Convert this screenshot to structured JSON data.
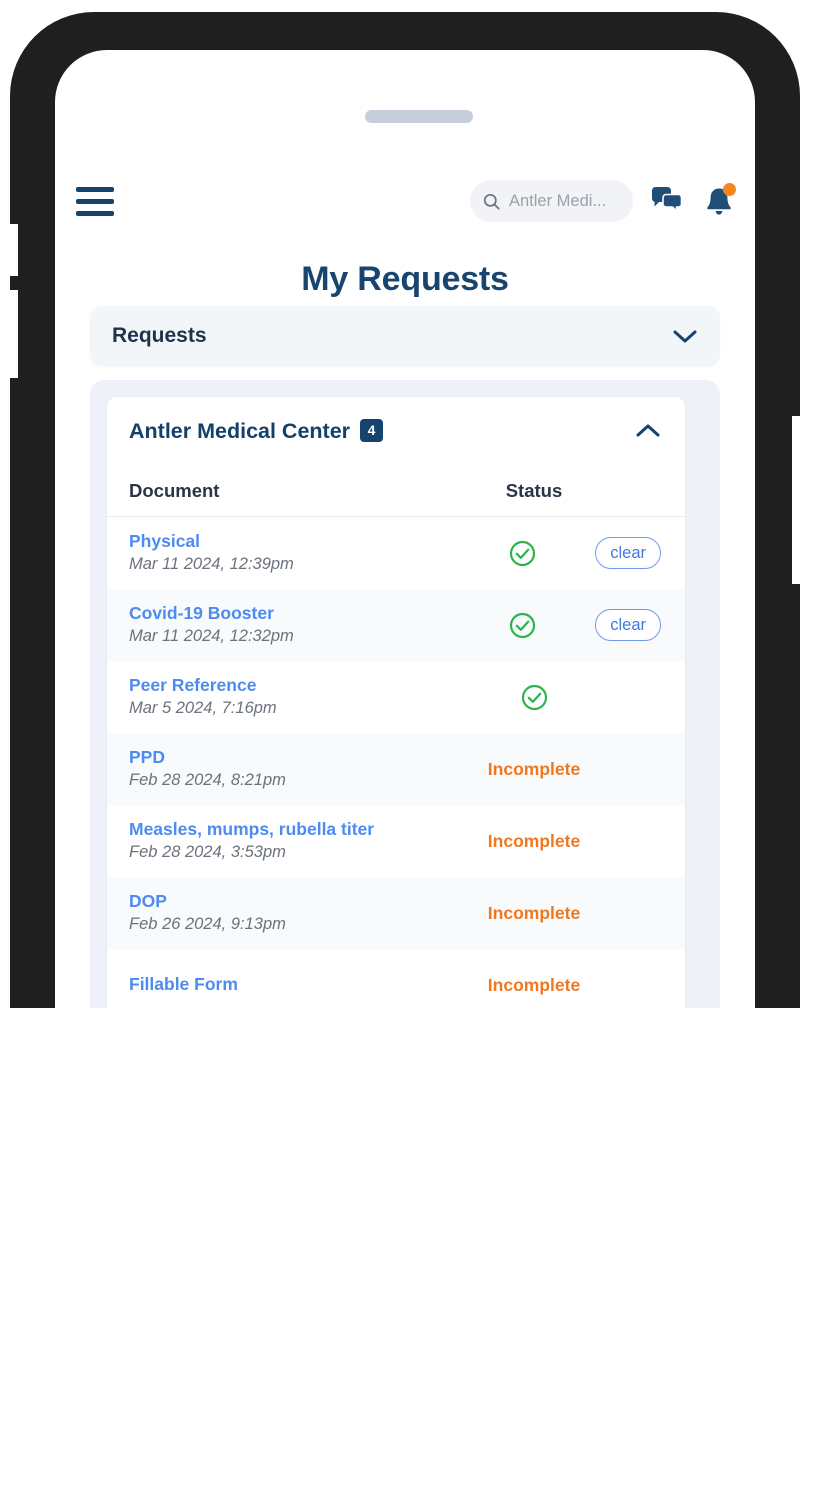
{
  "header": {
    "menu_icon": "hamburger-menu-icon",
    "search": {
      "icon": "search-icon",
      "value": "Antler Medi..."
    },
    "messages_icon": "chat-bubbles-icon",
    "notifications_icon": "bell-icon",
    "notification_badge": ""
  },
  "page": {
    "title": "My Requests"
  },
  "filter": {
    "label": "Requests",
    "chevron_icon": "chevron-down-icon"
  },
  "facility": {
    "name": "Antler Medical Center",
    "count": "4",
    "collapse_icon": "chevron-up-icon"
  },
  "table": {
    "columns": [
      "Document",
      "Status"
    ],
    "rows": [
      {
        "document": "Physical",
        "date": "Mar 11 2024, 12:39pm",
        "status": "complete",
        "status_icon": "check-circle-icon",
        "action": "clear"
      },
      {
        "document": "Covid-19 Booster",
        "date": "Mar 11 2024, 12:32pm",
        "status": "complete",
        "status_icon": "check-circle-icon",
        "action": "clear"
      },
      {
        "document": "Peer Reference",
        "date": "Mar 5 2024, 7:16pm",
        "status": "complete",
        "status_icon": "check-circle-icon",
        "action": ""
      },
      {
        "document": "PPD",
        "date": "Feb 28 2024, 8:21pm",
        "status": "Incomplete",
        "status_icon": "",
        "action": ""
      },
      {
        "document": "Measles, mumps, rubella titer",
        "date": "Feb 28 2024, 3:53pm",
        "status": "Incomplete",
        "status_icon": "",
        "action": ""
      },
      {
        "document": "DOP",
        "date": "Feb 26 2024, 9:13pm",
        "status": "Incomplete",
        "status_icon": "",
        "action": ""
      },
      {
        "document": "Fillable Form",
        "date": "",
        "status": "Incomplete",
        "status_icon": "",
        "action": ""
      }
    ]
  },
  "colors": {
    "brand_navy": "#16436e",
    "link_blue": "#4d8bf0",
    "status_green": "#2eb34a",
    "status_orange": "#f07820",
    "badge_orange": "#f5861f",
    "panel_bg": "#eef2f8"
  }
}
